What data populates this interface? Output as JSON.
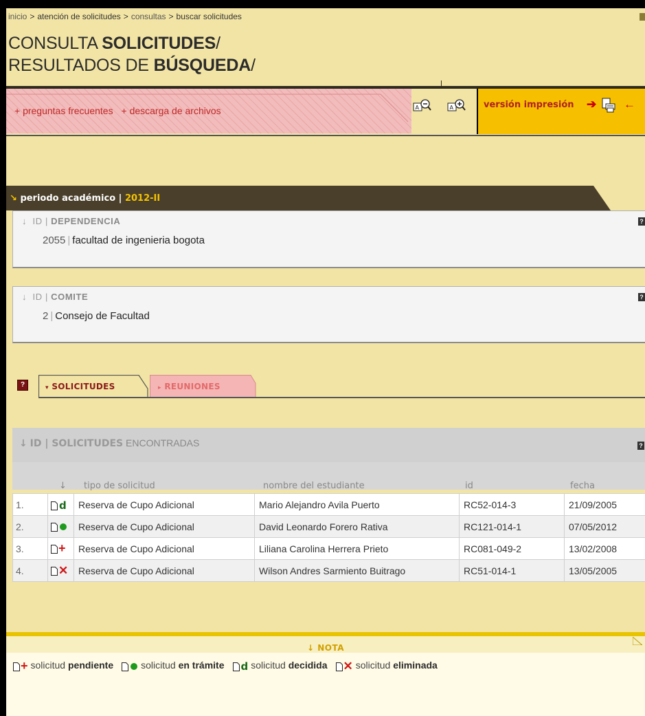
{
  "breadcrumb": {
    "items": [
      "inicio",
      "atención de solicitudes",
      "consultas",
      "buscar solicitudes"
    ],
    "separator": ">"
  },
  "title": {
    "line1_normal": "CONSULTA ",
    "line1_bold": "SOLICITUDES",
    "line2_normal": "RESULTADOS DE ",
    "line2_bold": "BÚSQUEDA",
    "slash": "/"
  },
  "linkbar": {
    "faq": "+ preguntas frecuentes",
    "downloads": "+ descarga de archivos",
    "print_label": "versión impresión"
  },
  "period": {
    "label": "periodo académico |",
    "value": "2012-II"
  },
  "dependencia": {
    "header_prefix": "ID | ",
    "header_bold": "DEPENDENCIA",
    "id": "2055",
    "name": "facultad de ingenieria bogota"
  },
  "comite": {
    "header_prefix": "ID | ",
    "header_bold": "COMITE",
    "id": "2",
    "name": "Consejo de Facultad"
  },
  "tabs": {
    "solicitudes": "SOLICITUDES",
    "reuniones": "REUNIONES"
  },
  "results": {
    "header_id": "ID | ",
    "header_bold": "SOLICITUDES",
    "header_rest": " ENCONTRADAS",
    "columns": [
      "tipo de solicitud",
      "nombre del estudiante",
      "id",
      "fecha"
    ],
    "rows": [
      {
        "num": "1.",
        "status": "decidida",
        "tipo": "Reserva de Cupo Adicional",
        "nombre": "Mario Alejandro Avila Puerto",
        "id": "RC52-014-3",
        "fecha": "21/09/2005"
      },
      {
        "num": "2.",
        "status": "tramite",
        "tipo": "Reserva de Cupo Adicional",
        "nombre": "David Leonardo Forero Rativa",
        "id": "RC121-014-1",
        "fecha": "07/05/2012"
      },
      {
        "num": "3.",
        "status": "pendiente",
        "tipo": "Reserva de Cupo Adicional",
        "nombre": "Liliana Carolina Herrera Prieto",
        "id": "RC081-049-2",
        "fecha": "13/02/2008"
      },
      {
        "num": "4.",
        "status": "eliminada",
        "tipo": "Reserva de Cupo Adicional",
        "nombre": "Wilson Andres Sarmiento Buitrago",
        "id": "RC51-014-1",
        "fecha": "13/05/2005"
      }
    ]
  },
  "nota": {
    "title": "NOTA",
    "legend": [
      {
        "prefix": "solicitud ",
        "bold": "pendiente"
      },
      {
        "prefix": "solicitud ",
        "bold": "en trámite"
      },
      {
        "prefix": "solicitud ",
        "bold": "decidida"
      },
      {
        "prefix": "solicitud ",
        "bold": "eliminada"
      }
    ]
  },
  "colors": {
    "background": "#f2e4a4",
    "link_red": "#c02828",
    "period_bar": "#4a3f2a",
    "period_value": "#f5c400",
    "print_box": "#f6c000",
    "tramite_green": "#1e9a1e",
    "decidida_green": "#1c6b1c",
    "pendiente_red": "#d01818"
  },
  "icons": {
    "zoom_out": "zoom-out-icon",
    "zoom_in": "zoom-in-icon",
    "print": "print-icon",
    "help": "help-icon",
    "sort": "sort-arrow-icon"
  }
}
